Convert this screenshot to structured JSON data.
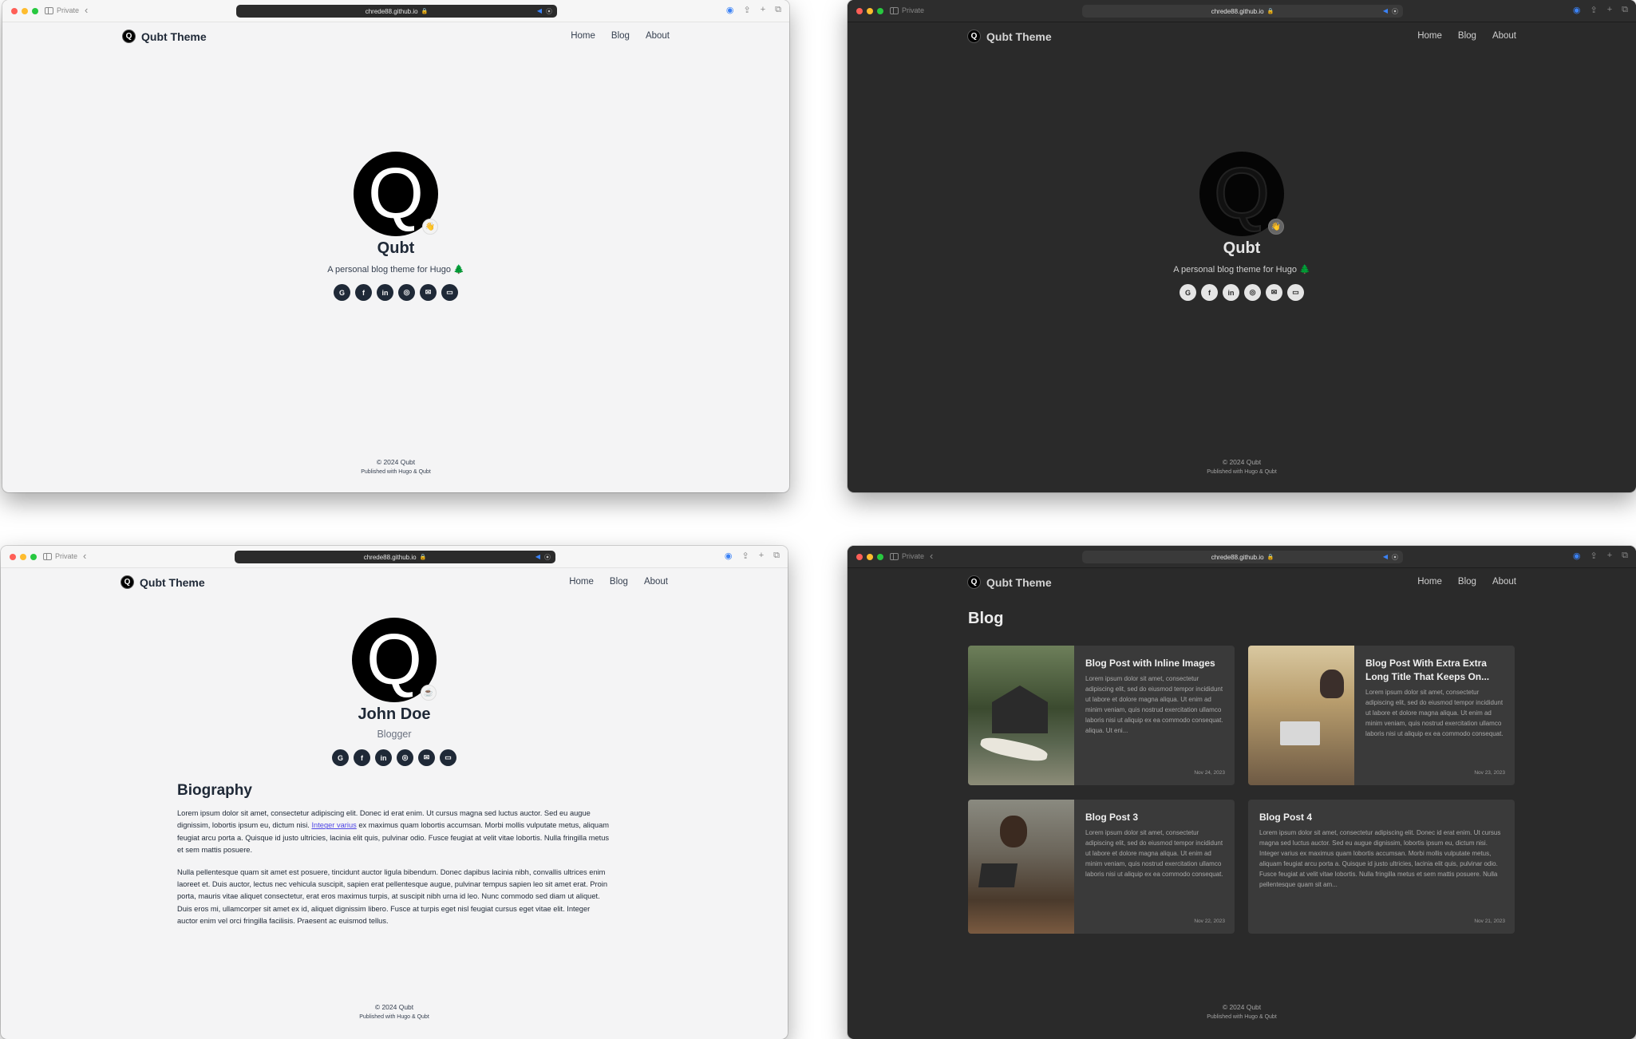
{
  "browser": {
    "private_label": "Private",
    "url": "chrede88.github.io"
  },
  "site": {
    "brand": "Qubt Theme",
    "logo_letter": "Q",
    "nav": [
      "Home",
      "Blog",
      "About"
    ]
  },
  "home": {
    "avatar_letter": "Q",
    "name": "Qubt",
    "tagline": "A personal blog theme for Hugo",
    "tagline_emoji": "🌲",
    "badge_emoji": "👋"
  },
  "social_icons": [
    "github-icon",
    "facebook-icon",
    "linkedin-icon",
    "instagram-icon",
    "email-icon",
    "laptop-icon"
  ],
  "about": {
    "avatar_letter": "Q",
    "name": "John Doe",
    "role": "Blogger",
    "badge_emoji": "☕",
    "bio_heading": "Biography",
    "para1_before": "Lorem ipsum dolor sit amet, consectetur adipiscing elit. Donec id erat enim. Ut cursus magna sed luctus auctor. Sed eu augue dignissim, lobortis ipsum eu, dictum nisi. ",
    "para1_link": "Integer varius",
    "para1_after": " ex maximus quam lobortis accumsan. Morbi mollis vulputate metus, aliquam feugiat arcu porta a. Quisque id justo ultricies, lacinia elit quis, pulvinar odio. Fusce feugiat at velit vitae lobortis. Nulla fringilla metus et sem mattis posuere.",
    "para2": "Nulla pellentesque quam sit amet est posuere, tincidunt auctor ligula bibendum. Donec dapibus lacinia nibh, convallis ultrices enim laoreet et. Duis auctor, lectus nec vehicula suscipit, sapien erat pellentesque augue, pulvinar tempus sapien leo sit amet erat. Proin porta, mauris vitae aliquet consectetur, erat eros maximus turpis, at suscipit nibh urna id leo. Nunc commodo sed diam ut aliquet. Duis eros mi, ullamcorper sit amet ex id, aliquet dignissim libero. Fusce at turpis eget nisl feugiat cursus eget vitae elit. Integer auctor enim vel orci fringilla facilisis. Praesent ac euismod tellus."
  },
  "blog": {
    "heading": "Blog",
    "posts": [
      {
        "title": "Blog Post with Inline Images",
        "excerpt": "Lorem ipsum dolor sit amet, consectetur adipiscing elit, sed do eiusmod tempor incididunt ut labore et dolore magna aliqua. Ut enim ad minim veniam, quis nostrud exercitation ullamco laboris nisi ut aliquip ex ea commodo consequat. aliqua. Ut eni...",
        "date": "Nov 24, 2023"
      },
      {
        "title": "Blog Post With Extra Extra Long Title That Keeps On...",
        "excerpt": "Lorem ipsum dolor sit amet, consectetur adipiscing elit, sed do eiusmod tempor incididunt ut labore et dolore magna aliqua. Ut enim ad minim veniam, quis nostrud exercitation ullamco laboris nisi ut aliquip ex ea commodo consequat.",
        "date": "Nov 23, 2023"
      },
      {
        "title": "Blog Post 3",
        "excerpt": "Lorem ipsum dolor sit amet, consectetur adipiscing elit, sed do eiusmod tempor incididunt ut labore et dolore magna aliqua. Ut enim ad minim veniam, quis nostrud exercitation ullamco laboris nisi ut aliquip ex ea commodo consequat.",
        "date": "Nov 22, 2023"
      },
      {
        "title": "Blog Post 4",
        "excerpt": "Lorem ipsum dolor sit amet, consectetur adipiscing elit. Donec id erat enim. Ut cursus magna sed luctus auctor. Sed eu augue dignissim, lobortis ipsum eu, dictum nisi. Integer varius ex maximus quam lobortis accumsan. Morbi mollis vulputate metus, aliquam feugiat arcu porta a. Quisque id justo ultricies, lacinia elit quis, pulvinar odio. Fusce feugiat at velit vitae lobortis. Nulla fringilla metus et sem mattis posuere. Nulla pellentesque quam sit am...",
        "date": "Nov 21, 2023"
      }
    ]
  },
  "footer": {
    "copyright": "© 2024 Qubt",
    "published": "Published with Hugo & Qubt"
  }
}
